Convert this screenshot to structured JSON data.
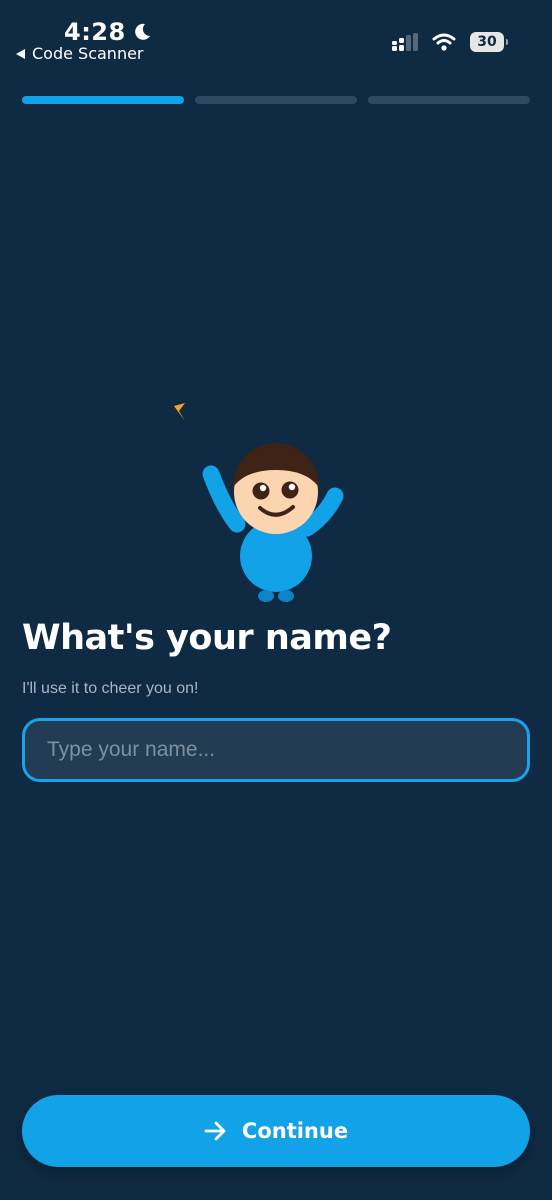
{
  "status_bar": {
    "time": "4:28",
    "back_app_label": "Code Scanner",
    "battery_level": "30",
    "icons": [
      "moon-icon",
      "cellular-signal-icon",
      "wifi-icon",
      "battery-icon"
    ]
  },
  "progress": {
    "total_steps": 3,
    "current_step": 1,
    "active_color": "#12a2e8",
    "inactive_color": "#2e4a63"
  },
  "mascot": {
    "icon": "waving-mascot-icon",
    "sparkle_color": "#f5a623",
    "body_color": "#12a2e8",
    "skin_color": "#fbd5b0",
    "hair_color": "#3e2416"
  },
  "main": {
    "title": "What's your name?",
    "subtitle": "I'll use it to cheer you on!",
    "name_input": {
      "placeholder": "Type your name...",
      "value": ""
    }
  },
  "footer": {
    "continue_label": "Continue",
    "continue_icon": "arrow-right-icon"
  },
  "colors": {
    "background": "#0f2a43",
    "accent": "#12a2e8",
    "input_bg": "#233b53"
  }
}
